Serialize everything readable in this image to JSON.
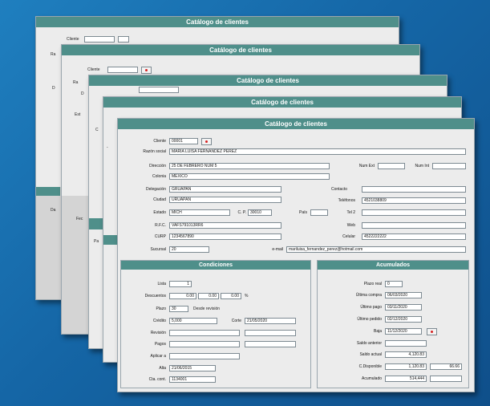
{
  "window_title": "Catálogo de clientes",
  "back": {
    "cliente_label": "Cliente",
    "r_label": "Ra",
    "d_label": "D",
    "e_label": "Est",
    "c_label": "C",
    "p_label": "Pa",
    "x_label": "Da",
    "f_label": "Fec",
    "dash": "-"
  },
  "form": {
    "cliente_label": "Cliente",
    "cliente_value": "00001",
    "razon_label": "Razón social",
    "razon_value": "MARIA LUISA FERNANDEZ PEREZ",
    "direccion_label": "Dirección",
    "direccion_value": "25 DE FEBRERO NUM 5",
    "numext_label": "Num Ext",
    "numint_label": "Num Int",
    "colonia_label": "Colonia",
    "colonia_value": "MEXICO",
    "delegacion_label": "Delegación",
    "delegacion_value": "GRUAPAN",
    "ciudad_label": "Ciudad",
    "ciudad_value": "URUAPAN",
    "estado_label": "Estado",
    "estado_value": "MICH",
    "cp_label": "C. P.",
    "cp_value": "30010",
    "pais_label": "País",
    "rfc_label": "R.F.C.",
    "rfc_value": "VAFS791013RR6",
    "curp_label": "CURP",
    "curp_value": "1234567890",
    "sucursal_label": "Sucursal",
    "sucursal_value": "20",
    "contacto_label": "Contacto",
    "telefonos_label": "Teléfonos",
    "telefonos_value": "4521038809",
    "tel2_label": "Tel 2",
    "web_label": "Web",
    "celular_label": "Celular",
    "celular_value": "4522222222",
    "email_label": "e-mail",
    "email_value": "mariluisa_fernandez_perez@hotmail.com"
  },
  "condiciones": {
    "title": "Condiciones",
    "lista_label": "Lista",
    "lista_value": "1",
    "descuentos_label": "Descuentos",
    "desc1": "0.00",
    "desc2": "0.00",
    "desc3": "0.00",
    "pct": "%",
    "plazo_label": "Plazo",
    "plazo_value": "30",
    "plazo_suffix": "Desde revisión",
    "credito_label": "Crédito",
    "credito_value": "5,000",
    "corte_label": "Corte",
    "corte_value": "21/05/2020",
    "revision_label": "Revisión",
    "pagos_label": "Pagos",
    "aplicar_label": "Aplicar a",
    "alta_label": "Alta",
    "alta_value": "21/06/2015",
    "cta_label": "Cta. cont.",
    "cta_value": "1134001"
  },
  "acumulados": {
    "title": "Acumulados",
    "plazo_real_label": "Plazo real",
    "plazo_real_value": "0",
    "ultima_compra_label": "Última compra",
    "ultima_compra_value": "06/03/2020",
    "ultimo_pago_label": "Último pago",
    "ultimo_pago_value": "03/11/2020",
    "ultimo_pedido_label": "Último pedido",
    "ultimo_pedido_value": "02/12/2020",
    "baja_label": "Baja",
    "baja_value": "11/12/2020",
    "saldo_anterior_label": "Saldo anterior",
    "saldo_actual_label": "Saldo actual",
    "saldo_actual_value": "4,120.83",
    "cdisp_label": "C.Disponible",
    "cdisp_value": "1,120.83",
    "cdisp_pct": "66.66",
    "acumulado_label": "Acumulado",
    "acumulado_value": "514,444"
  }
}
